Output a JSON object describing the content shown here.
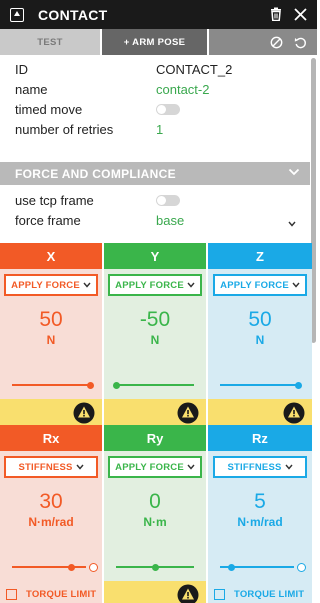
{
  "header": {
    "title": "CONTACT",
    "trash_icon": "trash-icon",
    "close_icon": "close-icon"
  },
  "tabs": {
    "test": "TEST",
    "arm_pose": "+ ARM POSE",
    "tools": [
      "ban-icon",
      "undo-icon"
    ]
  },
  "properties": {
    "id": {
      "label": "ID",
      "value": "CONTACT_2"
    },
    "name": {
      "label": "name",
      "value": "contact-2"
    },
    "timed_move": {
      "label": "timed move",
      "checked": false
    },
    "retries": {
      "label": "number of retries",
      "value": "1"
    }
  },
  "section": {
    "title": "FORCE AND COMPLIANCE"
  },
  "force": {
    "use_tcp_frame": {
      "label": "use tcp frame",
      "checked": false
    },
    "force_frame": {
      "label": "force frame",
      "value": "base"
    }
  },
  "colors": {
    "red": "#f25a26",
    "green": "#3ab54a",
    "blue": "#1aa9e6",
    "warn": "#f9df6e"
  },
  "axes": [
    {
      "name": "X",
      "mode": "APPLY FORCE",
      "value": "50",
      "unit": "N",
      "level": 1.0,
      "warning": true,
      "color": "red"
    },
    {
      "name": "Y",
      "mode": "APPLY FORCE",
      "value": "-50",
      "unit": "N",
      "level": 0.0,
      "warning": true,
      "color": "green"
    },
    {
      "name": "Z",
      "mode": "APPLY FORCE",
      "value": "50",
      "unit": "N",
      "level": 1.0,
      "warning": true,
      "color": "blue"
    },
    {
      "name": "Rx",
      "mode": "STIFFNESS",
      "value": "30",
      "unit": "N·m/rad",
      "level": 0.8,
      "limit": "TORQUE LIMIT",
      "color": "red"
    },
    {
      "name": "Ry",
      "mode": "APPLY FORCE",
      "value": "0",
      "unit": "N·m",
      "level": 0.5,
      "warning": true,
      "color": "green"
    },
    {
      "name": "Rz",
      "mode": "STIFFNESS",
      "value": "5",
      "unit": "N·m/rad",
      "level": 0.15,
      "limit": "TORQUE LIMIT",
      "color": "blue"
    }
  ]
}
